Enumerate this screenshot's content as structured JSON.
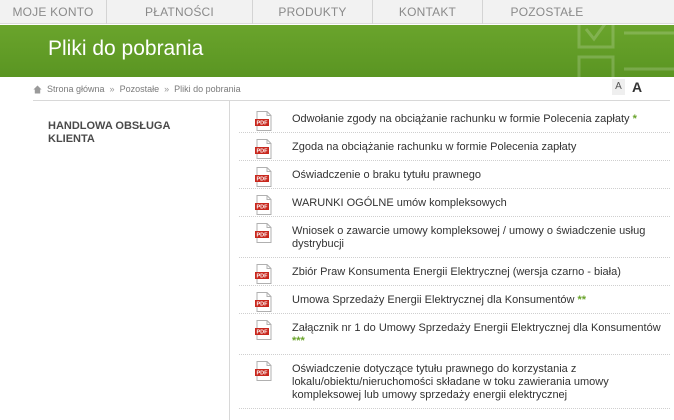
{
  "nav": {
    "items": [
      {
        "label": "MOJE KONTO",
        "w": 107
      },
      {
        "label": "PŁATNOŚCI",
        "w": 146
      },
      {
        "label": "PRODUKTY",
        "w": 120
      },
      {
        "label": "KONTAKT",
        "w": 110
      },
      {
        "label": "POZOSTAŁE",
        "w": 128
      }
    ]
  },
  "banner": {
    "title": "Pliki do pobrania"
  },
  "breadcrumb": {
    "home": "Strona główna",
    "separator": "»",
    "level1": "Pozostałe",
    "current": "Pliki do pobrania"
  },
  "font_controls": {
    "small": "A",
    "large": "A"
  },
  "sidebar": {
    "heading": "HANDLOWA OBSŁUGA KLIENTA"
  },
  "pdf_icon_text": "PDF",
  "documents": [
    {
      "label": "Odwołanie zgody na obciążanie rachunku w formie Polecenia zapłaty",
      "mark": "*"
    },
    {
      "label": "Zgoda na obciążanie rachunku w formie Polecenia zapłaty",
      "mark": ""
    },
    {
      "label": "Oświadczenie o braku tytułu prawnego",
      "mark": ""
    },
    {
      "label": "WARUNKI OGÓLNE umów kompleksowych",
      "mark": ""
    },
    {
      "label": "Wniosek o zawarcie umowy kompleksowej / umowy o świadczenie usług dystrybucji",
      "mark": ""
    },
    {
      "label": "Zbiór Praw Konsumenta Energii Elektrycznej (wersja czarno - biała)",
      "mark": ""
    },
    {
      "label": "Umowa Sprzedaży Energii Elektrycznej dla Konsumentów",
      "mark": "**"
    },
    {
      "label": "Załącznik nr 1 do Umowy Sprzedaży Energii Elektrycznej dla Konsumentów",
      "mark": "***"
    },
    {
      "label": "Oświadczenie dotyczące tytułu prawnego do korzystania z lokalu/obiektu/nieruchomości składane w toku zawierania umowy kompleksowej lub umowy sprzedaży energii elektrycznej",
      "mark": ""
    }
  ],
  "colors": {
    "brand_green": "#6aa42c",
    "pdf_red": "#c8281e"
  }
}
